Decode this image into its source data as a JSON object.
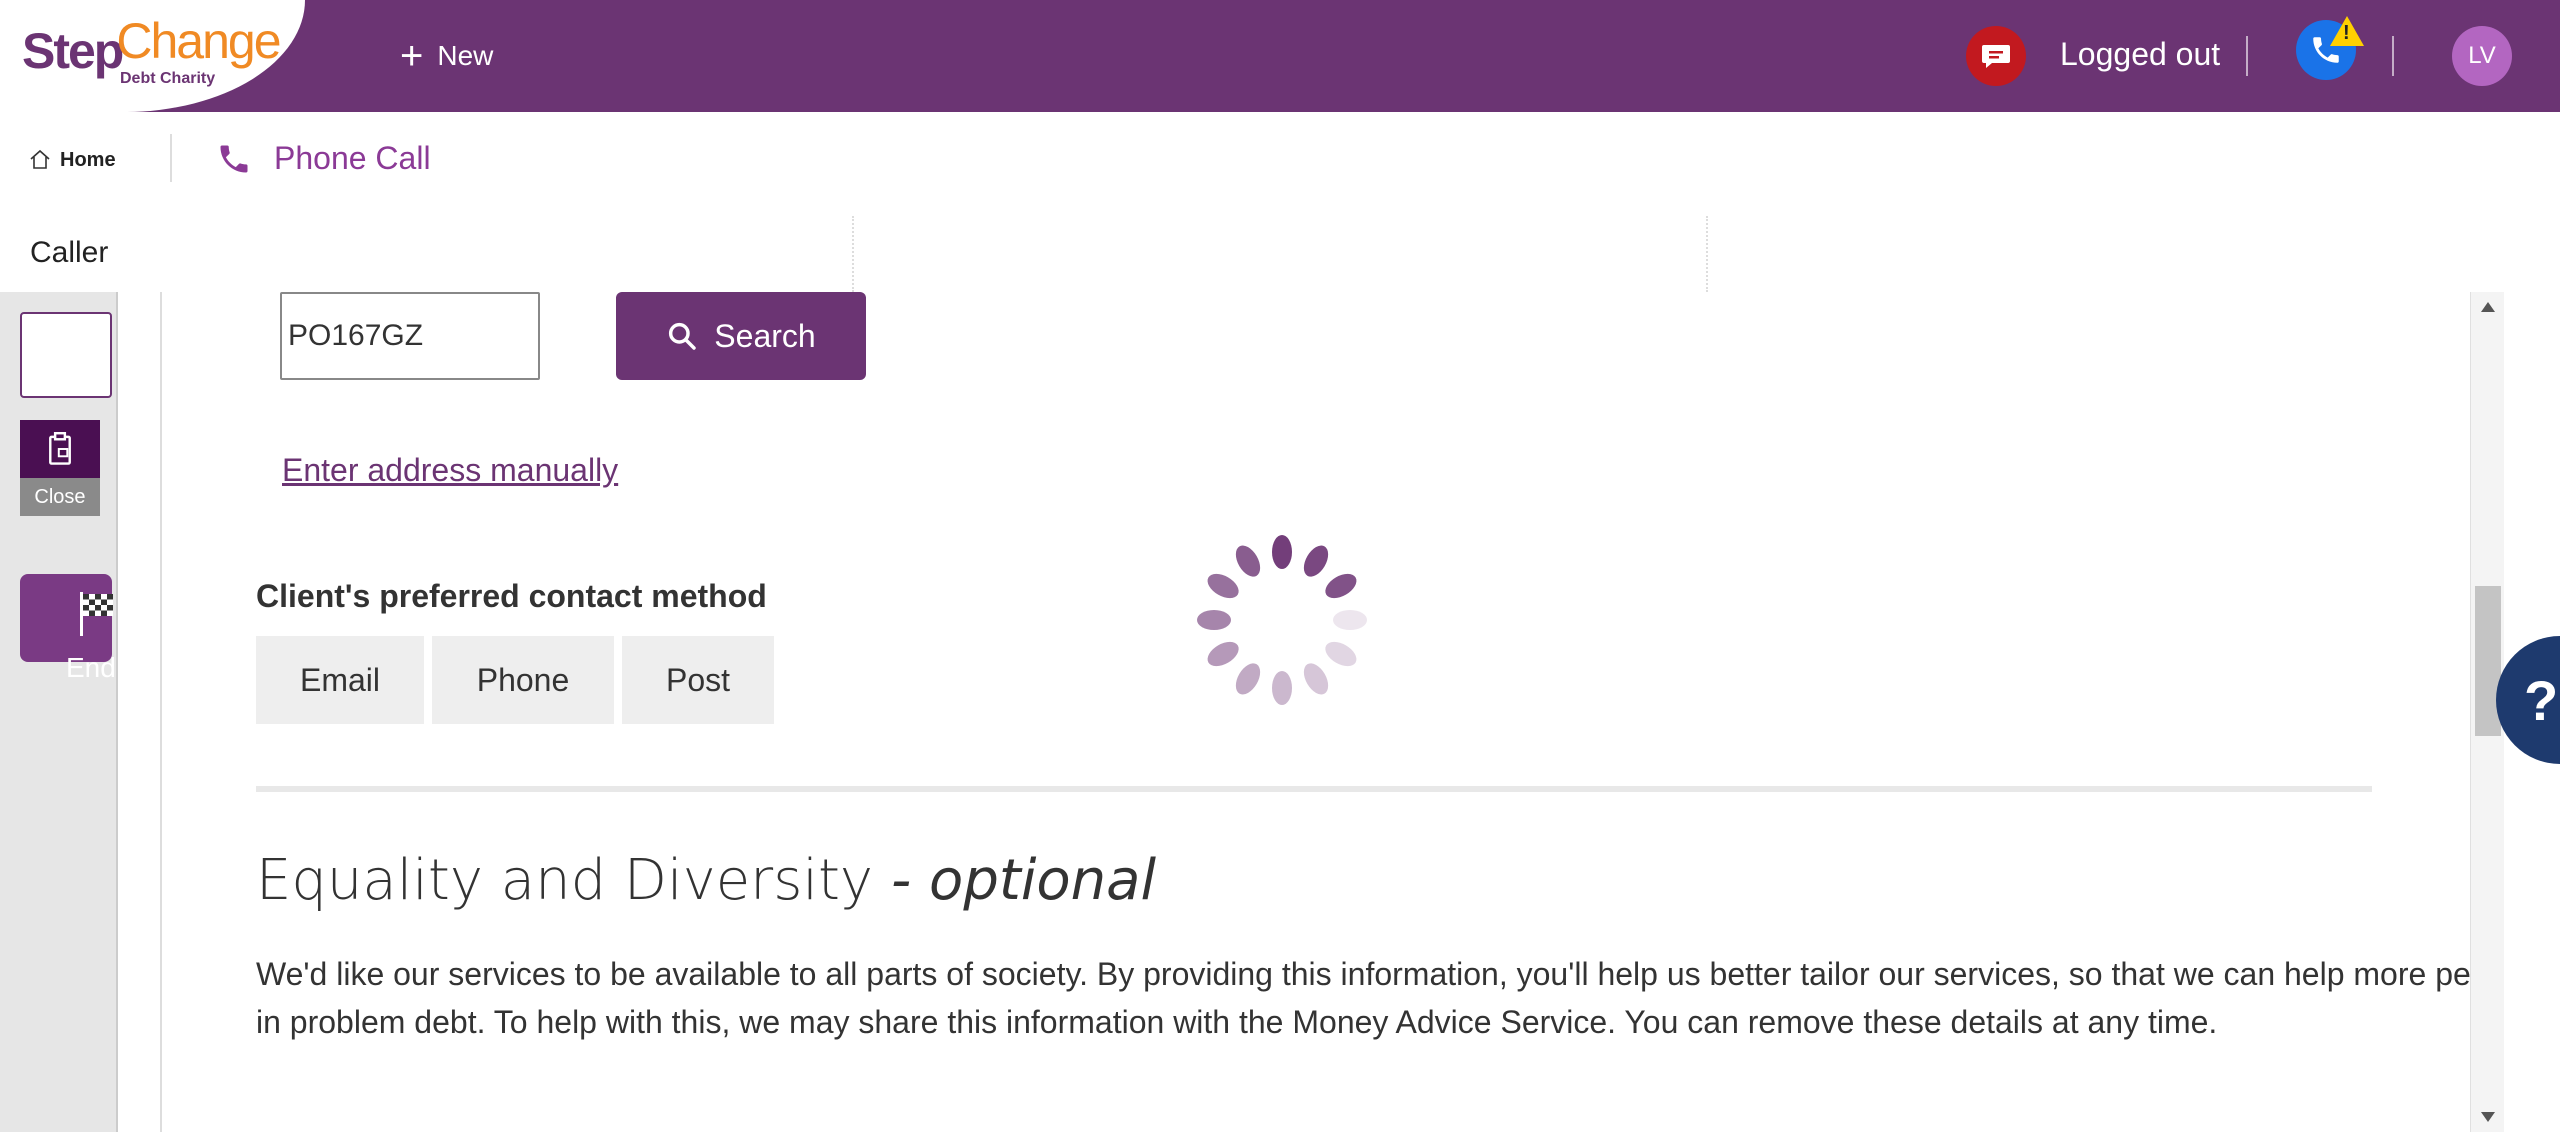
{
  "header": {
    "logo_step": "Step",
    "logo_change": "Change",
    "logo_sub": "Debt Charity",
    "new_label": "New",
    "status_text": "Logged out",
    "avatar_initials": "LV",
    "warning_symbol": "!"
  },
  "tabs": {
    "home_label": "Home",
    "phone_call_label": "Phone Call"
  },
  "caller": {
    "label": "Caller"
  },
  "rail": {
    "close_label": "Close",
    "end_session_label": "End Session"
  },
  "address": {
    "postcode_value": "PO167GZ",
    "search_label": "Search",
    "manual_link": "Enter address manually"
  },
  "contact": {
    "label": "Client's preferred contact method",
    "options": [
      "Email",
      "Phone",
      "Post"
    ]
  },
  "equality": {
    "title": "Equality and Diversity",
    "title_suffix": "- optional",
    "paragraph": "We'd like our services to be available to all parts of society. By providing this information, you'll help us better tailor our services, so that we can help more people in problem debt. To help with this, we may share this information with the Money Advice Service. You can remove these details at any time."
  },
  "help": {
    "label": "?"
  },
  "colors": {
    "brand_purple": "#6b3473",
    "brand_orange": "#f08a24",
    "alert_red": "#c2191f",
    "phone_blue": "#1a73e8",
    "help_navy": "#1e3a6e"
  }
}
